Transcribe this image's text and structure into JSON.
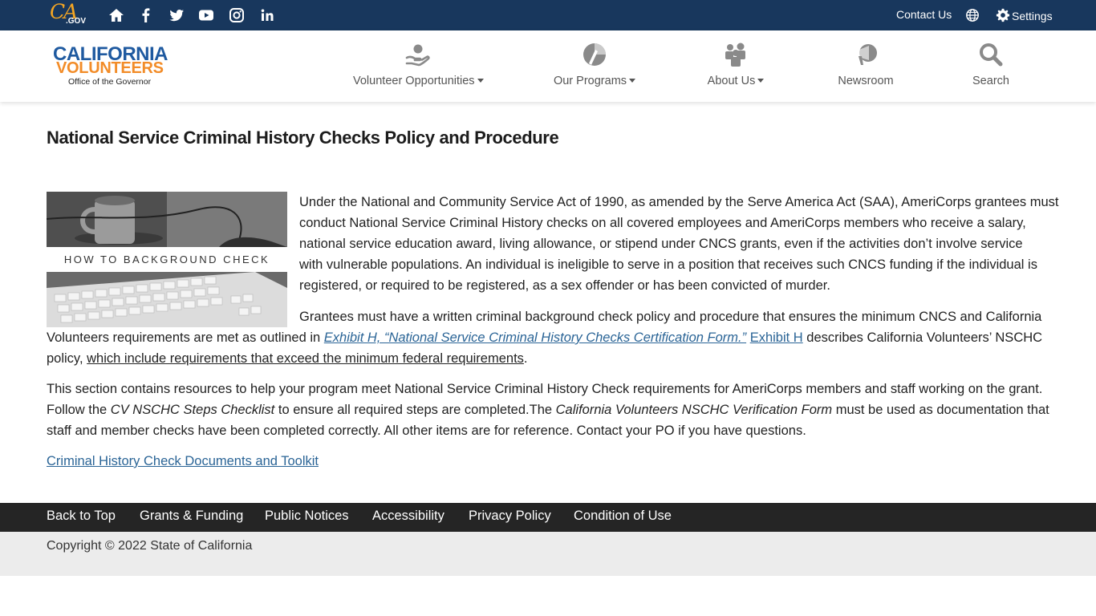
{
  "utility_bar": {
    "ca_logo": {
      "main": "CA",
      "sub": ".GOV"
    },
    "social_icons": [
      "home-icon",
      "facebook-icon",
      "twitter-icon",
      "youtube-icon",
      "instagram-icon",
      "linkedin-icon"
    ],
    "contact_label": "Contact Us",
    "settings_label": "Settings"
  },
  "header": {
    "brand": {
      "line1": "CALIFORNIA",
      "line2": "VOLUNTEERS",
      "line3": "Office of the Governor"
    },
    "nav": [
      {
        "label": "Volunteer Opportunities",
        "icon": "helping-hand-icon"
      },
      {
        "label": "Our Programs",
        "icon": "programs-icon"
      },
      {
        "label": "About Us",
        "icon": "people-icon"
      },
      {
        "label": "Newsroom",
        "icon": "megaphone-icon"
      },
      {
        "label": "Search",
        "icon": "search-icon"
      }
    ]
  },
  "main": {
    "title": "National Service Criminal History Checks Policy and Procedure",
    "hero_caption": "HOW TO BACKGROUND CHECK",
    "para1": [
      "Under the National and Community Service Act of 1990, as amended by the Serve America Act (SAA), AmeriCorps grantees must",
      "conduct National Service Criminal History checks on all covered employees and AmeriCorps members who receive a salary,",
      "national service education award, living allowance, or stipend under CNCS grants, even if the activities don’t involve service",
      "with vulnerable populations. An individual is ineligible to serve in a position that receives such CNCS funding if the individual is",
      "registered, or required to be registered, as a sex offender or has been convicted of murder."
    ],
    "para2": {
      "l1": "Grantees must have a written criminal background check policy and procedure that ensures the minimum CNCS and California",
      "l2_pre": "Volunteers requirements are met as outlined in ",
      "l2_link": "Exhibit H, “National Service Criminal History Checks Certification Form.”",
      "l2_link2": "Exhibit H",
      "l2_post": " describes California Volunteers’ NSCHC",
      "l3_pre": "policy, ",
      "l3_ul": "which include requirements that exceed the minimum federal requirements",
      "l3_post": "."
    },
    "para3": {
      "l1": "This section contains resources to help your program meet National Service Criminal History Check requirements for AmeriCorps members and staff working on the grant.",
      "l2_a": "Follow the ",
      "l2_em1": "CV NSCHC Steps Checklist",
      "l2_b": " to ensure all required steps are completed.The ",
      "l2_em2": "California Volunteers NSCHC Verification Form",
      "l2_c": " must be used as documentation that",
      "l3": "staff and member checks have been completed correctly. All other items are for reference. Contact your PO if you have questions."
    },
    "toolkit_link": "Criminal History Check Documents and Toolkit"
  },
  "footer": {
    "links": [
      "Back to Top",
      "Grants & Funding",
      "Public Notices",
      "Accessibility",
      "Privacy Policy",
      "Condition of Use"
    ],
    "copyright": "Copyright © 2022 State of California"
  },
  "colors": {
    "utility_bg": "#18375d",
    "brand_blue": "#1f5aa0",
    "brand_orange": "#f28c28",
    "link": "#2a6496",
    "footer_bg": "#252525"
  }
}
